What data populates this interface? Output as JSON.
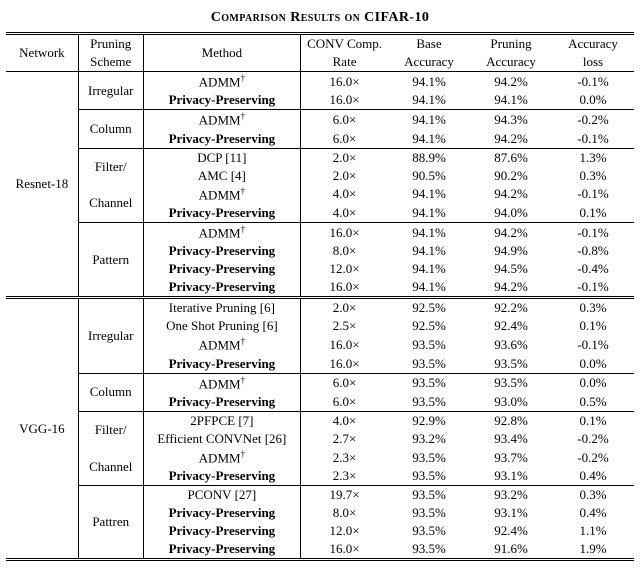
{
  "title": "Comparison Results on CIFAR-10",
  "headers": {
    "network": "Network",
    "pruning_scheme_l1": "Pruning",
    "pruning_scheme_l2": "Scheme",
    "method": "Method",
    "conv_l1": "CONV Comp.",
    "conv_l2": "Rate",
    "base_l1": "Base",
    "base_l2": "Accuracy",
    "pruning_l1": "Pruning",
    "pruning_l2": "Accuracy",
    "acc_l1": "Accuracy",
    "acc_l2": "loss"
  },
  "chart_data": {
    "type": "table",
    "title": "Comparison Results on CIFAR-10",
    "columns": [
      "Network",
      "Pruning Scheme",
      "Method",
      "CONV Comp. Rate",
      "Base Accuracy",
      "Pruning Accuracy",
      "Accuracy loss"
    ],
    "rows": [
      [
        "Resnet-18",
        "Irregular",
        "ADMM†",
        "16.0×",
        "94.1%",
        "94.2%",
        "-0.1%"
      ],
      [
        "Resnet-18",
        "Irregular",
        "Privacy-Preserving",
        "16.0×",
        "94.1%",
        "94.1%",
        "0.0%"
      ],
      [
        "Resnet-18",
        "Column",
        "ADMM†",
        "6.0×",
        "94.1%",
        "94.3%",
        "-0.2%"
      ],
      [
        "Resnet-18",
        "Column",
        "Privacy-Preserving",
        "6.0×",
        "94.1%",
        "94.2%",
        "-0.1%"
      ],
      [
        "Resnet-18",
        "Filter/Channel",
        "DCP [11]",
        "2.0×",
        "88.9%",
        "87.6%",
        "1.3%"
      ],
      [
        "Resnet-18",
        "Filter/Channel",
        "AMC [4]",
        "2.0×",
        "90.5%",
        "90.2%",
        "0.3%"
      ],
      [
        "Resnet-18",
        "Filter/Channel",
        "ADMM†",
        "4.0×",
        "94.1%",
        "94.2%",
        "-0.1%"
      ],
      [
        "Resnet-18",
        "Filter/Channel",
        "Privacy-Preserving",
        "4.0×",
        "94.1%",
        "94.0%",
        "0.1%"
      ],
      [
        "Resnet-18",
        "Pattern",
        "ADMM†",
        "16.0×",
        "94.1%",
        "94.2%",
        "-0.1%"
      ],
      [
        "Resnet-18",
        "Pattern",
        "Privacy-Preserving",
        "8.0×",
        "94.1%",
        "94.9%",
        "-0.8%"
      ],
      [
        "Resnet-18",
        "Pattern",
        "Privacy-Preserving",
        "12.0×",
        "94.1%",
        "94.5%",
        "-0.4%"
      ],
      [
        "Resnet-18",
        "Pattern",
        "Privacy-Preserving",
        "16.0×",
        "94.1%",
        "94.2%",
        "-0.1%"
      ],
      [
        "VGG-16",
        "Irregular",
        "Iterative Pruning [6]",
        "2.0×",
        "92.5%",
        "92.2%",
        "0.3%"
      ],
      [
        "VGG-16",
        "Irregular",
        "One Shot Pruning [6]",
        "2.5×",
        "92.5%",
        "92.4%",
        "0.1%"
      ],
      [
        "VGG-16",
        "Irregular",
        "ADMM†",
        "16.0×",
        "93.5%",
        "93.6%",
        "-0.1%"
      ],
      [
        "VGG-16",
        "Irregular",
        "Privacy-Preserving",
        "16.0×",
        "93.5%",
        "93.5%",
        "0.0%"
      ],
      [
        "VGG-16",
        "Column",
        "ADMM†",
        "6.0×",
        "93.5%",
        "93.5%",
        "0.0%"
      ],
      [
        "VGG-16",
        "Column",
        "Privacy-Preserving",
        "6.0×",
        "93.5%",
        "93.0%",
        "0.5%"
      ],
      [
        "VGG-16",
        "Filter/Channel",
        "2PFPCE [7]",
        "4.0×",
        "92.9%",
        "92.8%",
        "0.1%"
      ],
      [
        "VGG-16",
        "Filter/Channel",
        "Efficient CONVNet [26]",
        "2.7×",
        "93.2%",
        "93.4%",
        "-0.2%"
      ],
      [
        "VGG-16",
        "Filter/Channel",
        "ADMM†",
        "2.3×",
        "93.5%",
        "93.7%",
        "-0.2%"
      ],
      [
        "VGG-16",
        "Filter/Channel",
        "Privacy-Preserving",
        "2.3×",
        "93.5%",
        "93.1%",
        "0.4%"
      ],
      [
        "VGG-16",
        "Pattren",
        "PCONV [27]",
        "19.7×",
        "93.5%",
        "93.2%",
        "0.3%"
      ],
      [
        "VGG-16",
        "Pattren",
        "Privacy-Preserving",
        "8.0×",
        "93.5%",
        "93.1%",
        "0.4%"
      ],
      [
        "VGG-16",
        "Pattren",
        "Privacy-Preserving",
        "12.0×",
        "93.5%",
        "92.4%",
        "1.1%"
      ],
      [
        "VGG-16",
        "Pattren",
        "Privacy-Preserving",
        "16.0×",
        "93.5%",
        "91.6%",
        "1.9%"
      ]
    ]
  },
  "labels": {
    "admm_dagger": "ADMM",
    "dagger": "†",
    "privacy": "Privacy-Preserving",
    "resnet18": "Resnet-18",
    "vgg16": "VGG-16",
    "irregular": "Irregular",
    "column": "Column",
    "filter_l1": "Filter/",
    "filter_l2": "Channel",
    "pattern": "Pattern",
    "pattren_typo": "Pattren",
    "dcp": "DCP [11]",
    "amc": "AMC [4]",
    "iterative": "Iterative Pruning [6]",
    "oneshot": "One Shot Pruning [6]",
    "twopfpce": "2PFPCE [7]",
    "effconv": "Efficient CONVNet [26]",
    "pconv": "PCONV [27]"
  },
  "vals": {
    "r1": {
      "rate": "16.0×",
      "base": "94.1%",
      "prune": "94.2%",
      "loss": "-0.1%"
    },
    "r2": {
      "rate": "16.0×",
      "base": "94.1%",
      "prune": "94.1%",
      "loss": "0.0%"
    },
    "r3": {
      "rate": "6.0×",
      "base": "94.1%",
      "prune": "94.3%",
      "loss": "-0.2%"
    },
    "r4": {
      "rate": "6.0×",
      "base": "94.1%",
      "prune": "94.2%",
      "loss": "-0.1%"
    },
    "r5": {
      "rate": "2.0×",
      "base": "88.9%",
      "prune": "87.6%",
      "loss": "1.3%"
    },
    "r6": {
      "rate": "2.0×",
      "base": "90.5%",
      "prune": "90.2%",
      "loss": "0.3%"
    },
    "r7": {
      "rate": "4.0×",
      "base": "94.1%",
      "prune": "94.2%",
      "loss": "-0.1%"
    },
    "r8": {
      "rate": "4.0×",
      "base": "94.1%",
      "prune": "94.0%",
      "loss": "0.1%"
    },
    "r9": {
      "rate": "16.0×",
      "base": "94.1%",
      "prune": "94.2%",
      "loss": "-0.1%"
    },
    "r10": {
      "rate": "8.0×",
      "base": "94.1%",
      "prune": "94.9%",
      "loss": "-0.8%"
    },
    "r11": {
      "rate": "12.0×",
      "base": "94.1%",
      "prune": "94.5%",
      "loss": "-0.4%"
    },
    "r12": {
      "rate": "16.0×",
      "base": "94.1%",
      "prune": "94.2%",
      "loss": "-0.1%"
    },
    "r13": {
      "rate": "2.0×",
      "base": "92.5%",
      "prune": "92.2%",
      "loss": "0.3%"
    },
    "r14": {
      "rate": "2.5×",
      "base": "92.5%",
      "prune": "92.4%",
      "loss": "0.1%"
    },
    "r15": {
      "rate": "16.0×",
      "base": "93.5%",
      "prune": "93.6%",
      "loss": "-0.1%"
    },
    "r16": {
      "rate": "16.0×",
      "base": "93.5%",
      "prune": "93.5%",
      "loss": "0.0%"
    },
    "r17": {
      "rate": "6.0×",
      "base": "93.5%",
      "prune": "93.5%",
      "loss": "0.0%"
    },
    "r18": {
      "rate": "6.0×",
      "base": "93.5%",
      "prune": "93.0%",
      "loss": "0.5%"
    },
    "r19": {
      "rate": "4.0×",
      "base": "92.9%",
      "prune": "92.8%",
      "loss": "0.1%"
    },
    "r20": {
      "rate": "2.7×",
      "base": "93.2%",
      "prune": "93.4%",
      "loss": "-0.2%"
    },
    "r21": {
      "rate": "2.3×",
      "base": "93.5%",
      "prune": "93.7%",
      "loss": "-0.2%"
    },
    "r22": {
      "rate": "2.3×",
      "base": "93.5%",
      "prune": "93.1%",
      "loss": "0.4%"
    },
    "r23": {
      "rate": "19.7×",
      "base": "93.5%",
      "prune": "93.2%",
      "loss": "0.3%"
    },
    "r24": {
      "rate": "8.0×",
      "base": "93.5%",
      "prune": "93.1%",
      "loss": "0.4%"
    },
    "r25": {
      "rate": "12.0×",
      "base": "93.5%",
      "prune": "92.4%",
      "loss": "1.1%"
    },
    "r26": {
      "rate": "16.0×",
      "base": "93.5%",
      "prune": "91.6%",
      "loss": "1.9%"
    }
  }
}
